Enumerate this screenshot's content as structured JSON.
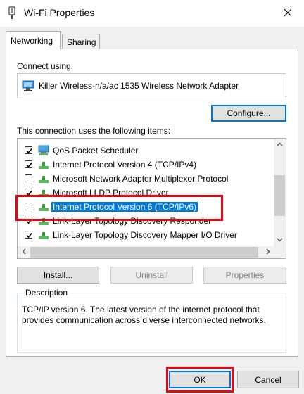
{
  "window": {
    "title": "Wi-Fi Properties"
  },
  "tabs": [
    {
      "label": "Networking",
      "active": true
    },
    {
      "label": "Sharing",
      "active": false
    }
  ],
  "connect_using_label": "Connect using:",
  "adapter_name": "Killer Wireless-n/a/ac 1535 Wireless Network Adapter",
  "configure_label": "Configure...",
  "items_label": "This connection uses the following items:",
  "items": [
    {
      "label": "QoS Packet Scheduler",
      "checked": true
    },
    {
      "label": "Internet Protocol Version 4 (TCP/IPv4)",
      "checked": true
    },
    {
      "label": "Microsoft Network Adapter Multiplexor Protocol",
      "checked": false
    },
    {
      "label": "Microsoft LLDP Protocol Driver",
      "checked": true
    },
    {
      "label": "Internet Protocol Version 6 (TCP/IPv6)",
      "checked": false,
      "selected": true
    },
    {
      "label": "Link-Layer Topology Discovery Responder",
      "checked": true
    },
    {
      "label": "Link-Layer Topology Discovery Mapper I/O Driver",
      "checked": true
    }
  ],
  "buttons": {
    "install": "Install...",
    "uninstall": "Uninstall",
    "properties": "Properties"
  },
  "description": {
    "legend": "Description",
    "text": "TCP/IP version 6. The latest version of the internet protocol that provides communication across diverse interconnected networks."
  },
  "footer": {
    "ok": "OK",
    "cancel": "Cancel"
  },
  "colors": {
    "selection": "#0078d7",
    "highlight": "#e30613"
  }
}
